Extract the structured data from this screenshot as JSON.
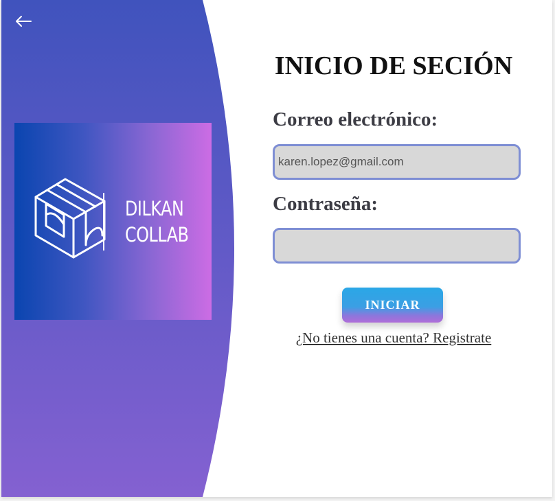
{
  "nav": {
    "back_icon": "arrow-left-icon"
  },
  "brand": {
    "line1": "DILKAN",
    "line2": "COLLAB",
    "gradient_colors": [
      "#0a45b0",
      "#cc6ce4"
    ]
  },
  "form": {
    "title": "INICIO DE SECIÓN",
    "email_label": "Correo electrónico:",
    "email_value": "karen.lopez@gmail.com",
    "password_label": "Contraseña:",
    "password_value": "",
    "submit_label": "INICIAR",
    "register_link": "¿No tienes una cuenta? Registrate"
  },
  "colors": {
    "panel_top": "#4053bd",
    "panel_bottom": "#8461d1",
    "input_border": "#7e8ed4",
    "input_bg": "#d8d8d8",
    "button_top": "#2aa7e6",
    "button_bottom": "#b06dd9"
  }
}
